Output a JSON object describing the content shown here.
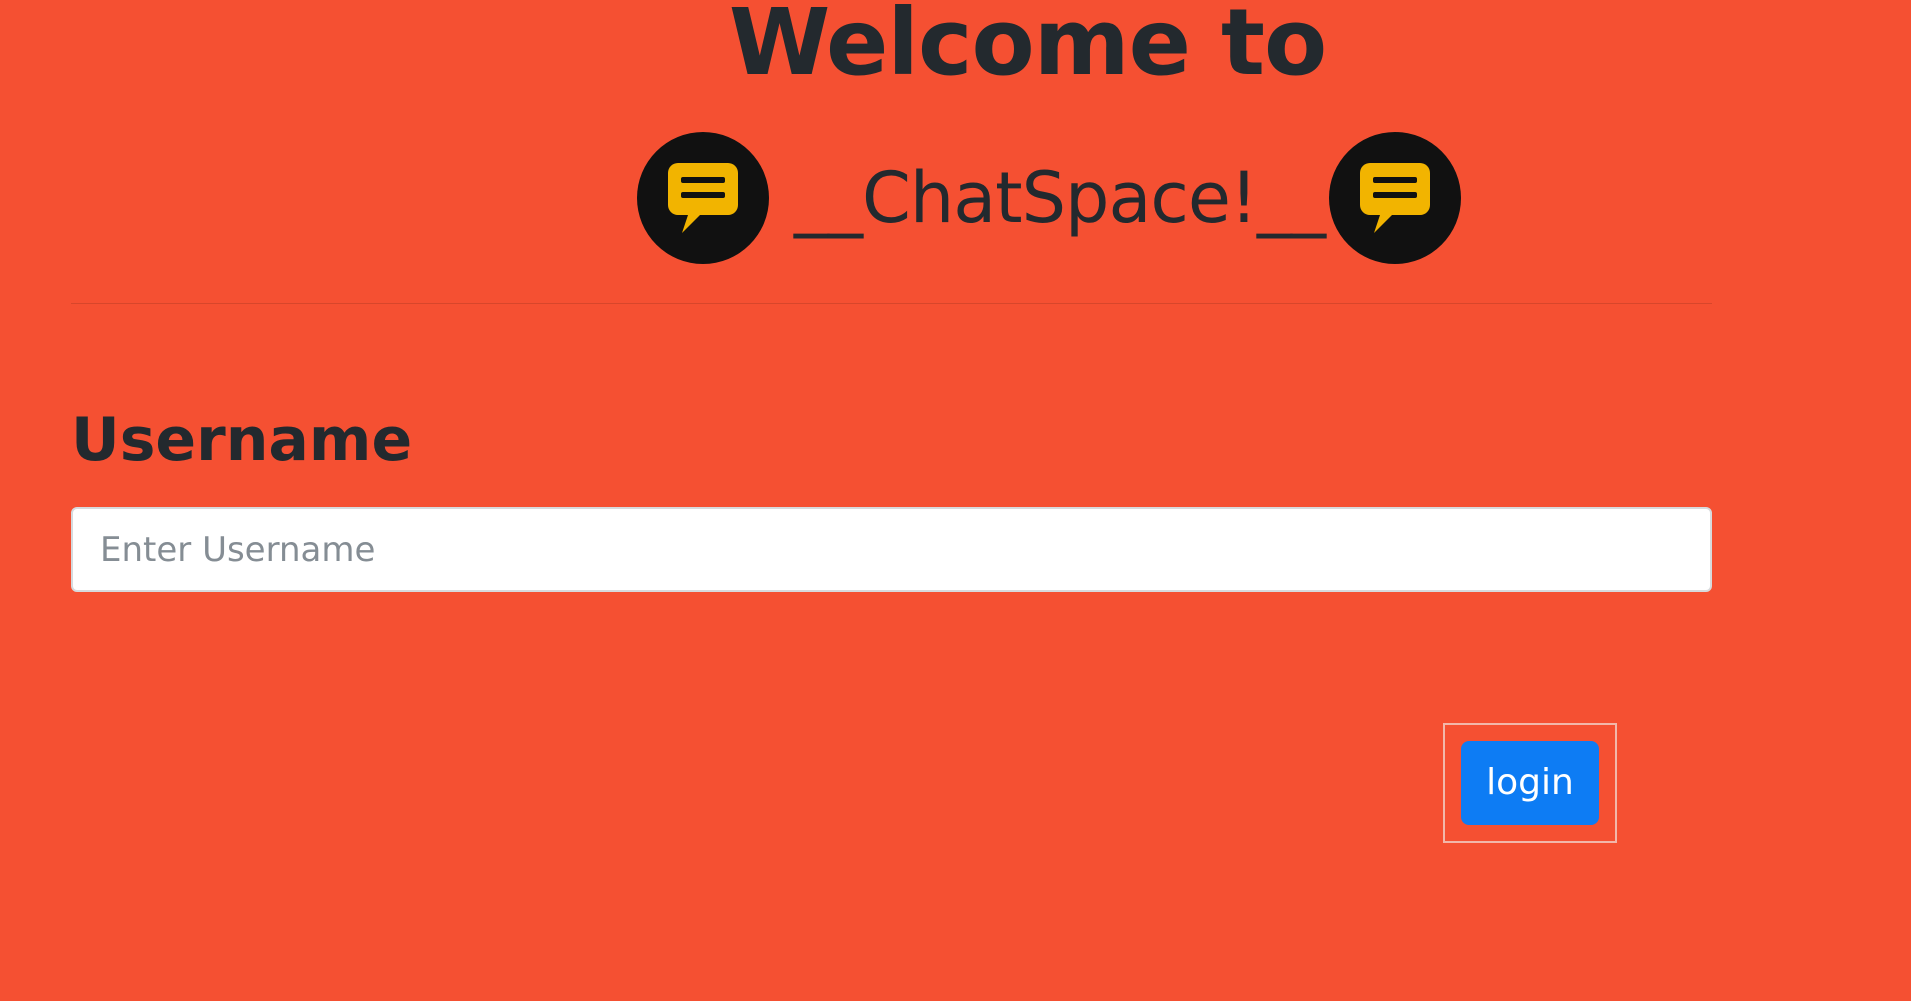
{
  "header": {
    "title": "Welcome to",
    "brand": "__ChatSpace!__",
    "logo_icon": "chat-message-icon"
  },
  "form": {
    "label": "Username",
    "input_value": "",
    "placeholder": "Enter Username",
    "button_label": "login"
  },
  "colors": {
    "background": "#f55032",
    "text": "#23292e",
    "logo_circle": "#111111",
    "logo_bubble": "#f2b400",
    "button": "#0d7cf4",
    "button_text": "#ffffff"
  }
}
